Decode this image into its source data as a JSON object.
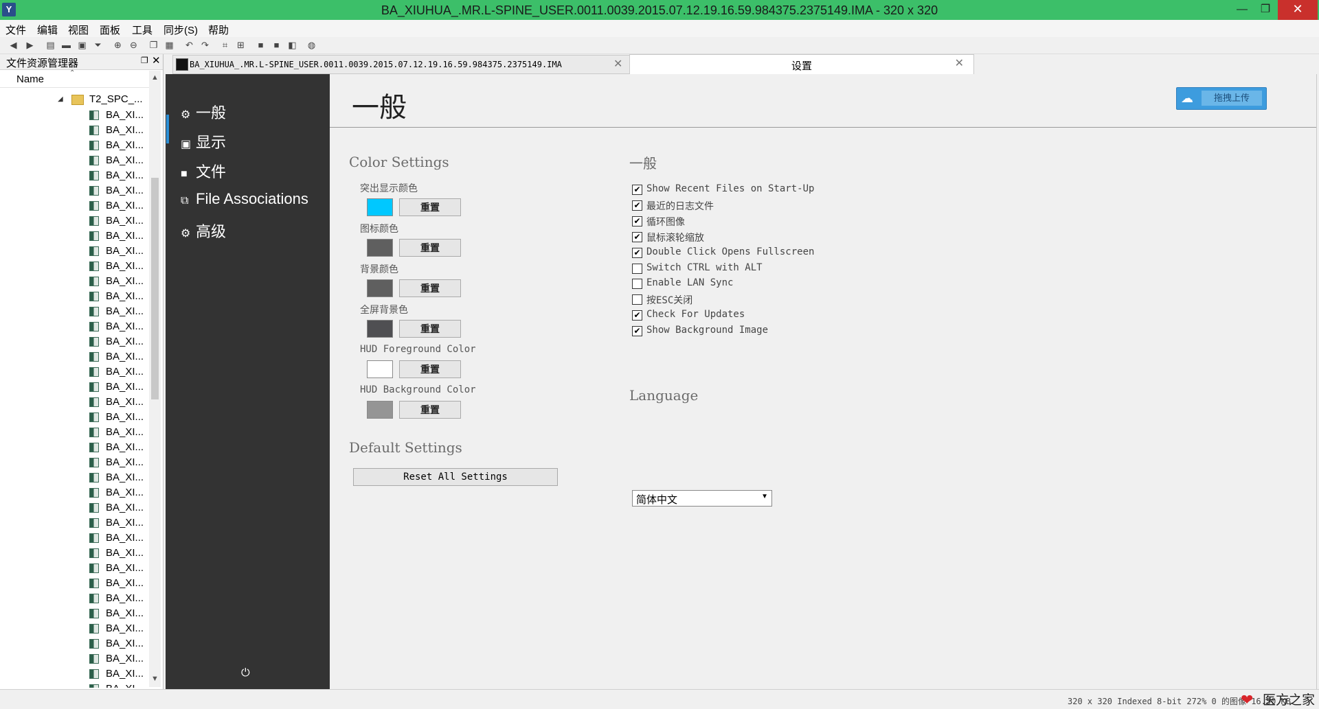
{
  "window": {
    "title": "BA_XIUHUA_.MR.L-SPINE_USER.0011.0039.2015.07.12.19.16.59.984375.2375149.IMA  -  320 x 320",
    "app_icon": "Y",
    "minimize": "—",
    "maximize": "❐",
    "close": "✕"
  },
  "menu": [
    "文件",
    "编辑",
    "视图",
    "面板",
    "工具",
    "同步(S)",
    "帮助"
  ],
  "explorer": {
    "title": "文件资源管理器",
    "column_name": "Name",
    "root_folder": "T2_SPC_...",
    "files": [
      "BA_XI...",
      "BA_XI...",
      "BA_XI...",
      "BA_XI...",
      "BA_XI...",
      "BA_XI...",
      "BA_XI...",
      "BA_XI...",
      "BA_XI...",
      "BA_XI...",
      "BA_XI...",
      "BA_XI...",
      "BA_XI...",
      "BA_XI...",
      "BA_XI...",
      "BA_XI...",
      "BA_XI...",
      "BA_XI...",
      "BA_XI...",
      "BA_XI...",
      "BA_XI...",
      "BA_XI...",
      "BA_XI...",
      "BA_XI...",
      "BA_XI...",
      "BA_XI...",
      "BA_XI...",
      "BA_XI...",
      "BA_XI...",
      "BA_XI...",
      "BA_XI...",
      "BA_XI...",
      "BA_XI...",
      "BA_XI...",
      "BA_XI...",
      "BA_XI...",
      "BA_XI...",
      "BA_XI...",
      "BA_XI..."
    ]
  },
  "tabs": {
    "image_tab": "BA_XIUHUA_.MR.L-SPINE_USER.0011.0039.2015.07.12.19.16.59.984375.2375149.IMA",
    "settings_tab": "设置",
    "close_glyph": "✕"
  },
  "nav": {
    "items": [
      {
        "icon": "⚙",
        "label": "一般"
      },
      {
        "icon": "▣",
        "label": "显示"
      },
      {
        "icon": "■",
        "label": "文件"
      },
      {
        "icon": "⧉",
        "label": "File Associations"
      },
      {
        "icon": "⚙",
        "label": "高级"
      }
    ],
    "power_glyph": "⏻"
  },
  "content": {
    "page_title": "一般",
    "upload_label": "拖拽上传",
    "color_settings": {
      "heading": "Color Settings",
      "reset_label": "重置",
      "items": [
        {
          "label": "突出显示颜色",
          "color": "#00c8ff"
        },
        {
          "label": "图标颜色",
          "color": "#5f5f5f"
        },
        {
          "label": "背景颜色",
          "color": "#5f5f5f"
        },
        {
          "label": "全屏背景色",
          "color": "#4f4f52"
        },
        {
          "label": "HUD Foreground Color",
          "color": "#ffffff"
        },
        {
          "label": "HUD Background Color",
          "color": "#959595"
        }
      ]
    },
    "default_settings": {
      "heading": "Default Settings",
      "button": "Reset All Settings"
    },
    "general": {
      "heading": "一般",
      "options": [
        {
          "label": "Show Recent Files on Start-Up",
          "checked": true
        },
        {
          "label": "最近的日志文件",
          "checked": true
        },
        {
          "label": "循环图像",
          "checked": true
        },
        {
          "label": "鼠标滚轮缩放",
          "checked": true
        },
        {
          "label": "Double Click Opens Fullscreen",
          "checked": true
        },
        {
          "label": "Switch CTRL with ALT",
          "checked": false
        },
        {
          "label": "Enable LAN Sync",
          "checked": false
        },
        {
          "label": "按ESC关闭",
          "checked": false
        },
        {
          "label": "Check For Updates",
          "checked": true
        },
        {
          "label": "Show Background Image",
          "checked": true
        }
      ]
    },
    "language": {
      "heading": "Language",
      "selected": "简体中文"
    }
  },
  "status": {
    "text": "320 x 320 Indexed 8-bit 272% 0 的图像 16.50 KB",
    "brand": "医方之家"
  }
}
